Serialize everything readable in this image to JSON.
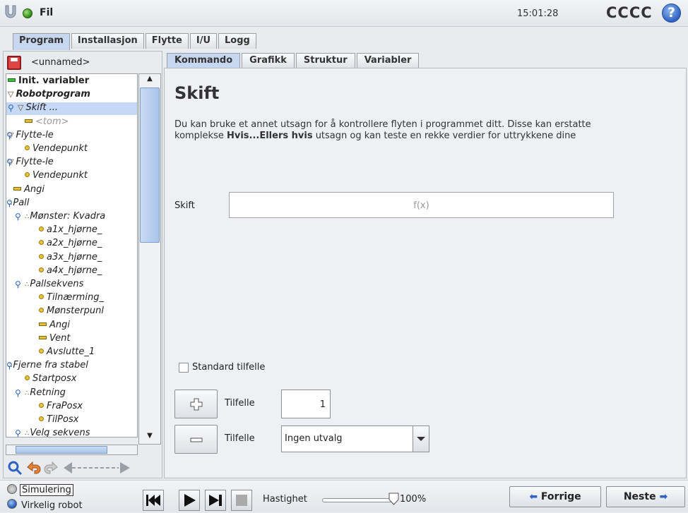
{
  "header": {
    "file_menu": "Fil",
    "time": "15:01:28",
    "robot_name": "CCCC",
    "help_glyph": "?"
  },
  "main_tabs": [
    {
      "label": "Program",
      "active": true
    },
    {
      "label": "Installasjon",
      "active": false
    },
    {
      "label": "Flytte",
      "active": false
    },
    {
      "label": "I/U",
      "active": false
    },
    {
      "label": "Logg",
      "active": false
    }
  ],
  "program": {
    "name": "<unnamed>"
  },
  "tree": [
    {
      "label": "Init. variabler",
      "icon": "bar-green-icon",
      "style": "bold"
    },
    {
      "label": "Robotprogram",
      "icon": "triangle-icon",
      "style": "bold-italic"
    },
    {
      "label": "Skift ...",
      "icon": "triangle-icon",
      "selected": true
    },
    {
      "label": "<tom>",
      "icon": "bar-icon",
      "style": "muted"
    },
    {
      "label": "Flytte-le",
      "icon": "triangle-icon"
    },
    {
      "label": "Vendepunkt",
      "icon": "waypoint-icon"
    },
    {
      "label": "Flytte-le",
      "icon": "triangle-icon"
    },
    {
      "label": "Vendepunkt",
      "icon": "waypoint-icon"
    },
    {
      "label": "Angi",
      "icon": "bar-icon"
    },
    {
      "label": "Pall",
      "icon": "pallet-icon"
    },
    {
      "label": "Mønster: Kvadra",
      "icon": "pallet-icon"
    },
    {
      "label": "a1x_hjørne_",
      "icon": "waypoint-icon"
    },
    {
      "label": "a2x_hjørne_",
      "icon": "waypoint-icon"
    },
    {
      "label": "a3x_hjørne_",
      "icon": "waypoint-icon"
    },
    {
      "label": "a4x_hjørne_",
      "icon": "waypoint-icon"
    },
    {
      "label": "Pallsekvens",
      "icon": "pallet-icon"
    },
    {
      "label": "Tilnærming_",
      "icon": "waypoint-icon"
    },
    {
      "label": "Mønsterpunl",
      "icon": "waypoint-icon"
    },
    {
      "label": "Angi",
      "icon": "bar-icon"
    },
    {
      "label": "Vent",
      "icon": "bar-icon"
    },
    {
      "label": "Avslutte_1",
      "icon": "waypoint-icon"
    },
    {
      "label": "Fjerne fra stabel",
      "icon": "pallet-icon"
    },
    {
      "label": "Startposx",
      "icon": "waypoint-icon"
    },
    {
      "label": "Retning",
      "icon": "pallet-icon"
    },
    {
      "label": "FraPosx",
      "icon": "waypoint-icon"
    },
    {
      "label": "TilPosx",
      "icon": "waypoint-icon"
    },
    {
      "label": "Velg sekvens",
      "icon": "pallet-icon"
    }
  ],
  "sub_tabs": [
    {
      "label": "Kommando",
      "active": true
    },
    {
      "label": "Grafikk",
      "active": false
    },
    {
      "label": "Struktur",
      "active": false
    },
    {
      "label": "Variabler",
      "active": false
    }
  ],
  "command": {
    "title": "Skift",
    "desc_part1": "Du kan bruke et annet utsagn for å kontrollere flyten i programmet ditt. Disse kan erstatte komplekse ",
    "desc_bold": "Hvis...Ellers hvis",
    "desc_part2": " utsagn og kan teste en rekke verdier for uttrykkene dine",
    "switch_label": "Skift",
    "switch_placeholder": "f(x)",
    "default_case_label": "Standard tilfelle",
    "case_label_add": "Tilfelle",
    "case_value": "1",
    "case_label_remove": "Tilfelle",
    "case_select_value": "Ingen utvalg"
  },
  "footer": {
    "mode_simulation": "Simulering",
    "mode_real": "Virkelig robot",
    "speed_label": "Hastighet",
    "speed_value": "100%",
    "speed_fraction": 1.0,
    "prev_label": "Forrige",
    "next_label": "Neste"
  },
  "colors": {
    "accent": "#2f63c2",
    "tab_active": "#c7d7f0",
    "selected_row": "#c5d8f5"
  }
}
